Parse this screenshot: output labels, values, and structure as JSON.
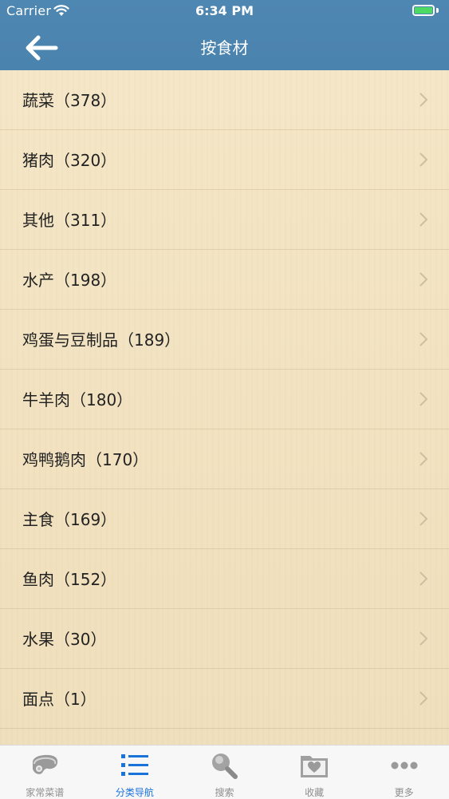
{
  "status_bar": {
    "carrier": "Carrier",
    "time": "6:34 PM"
  },
  "nav": {
    "title": "按食材"
  },
  "categories": [
    {
      "label": "蔬菜（378）"
    },
    {
      "label": "猪肉（320）"
    },
    {
      "label": "其他（311）"
    },
    {
      "label": "水产（198）"
    },
    {
      "label": "鸡蛋与豆制品（189）"
    },
    {
      "label": "牛羊肉（180）"
    },
    {
      "label": "鸡鸭鹅肉（170）"
    },
    {
      "label": "主食（169）"
    },
    {
      "label": "鱼肉（152）"
    },
    {
      "label": "水果（30）"
    },
    {
      "label": "面点（1）"
    }
  ],
  "tabs": [
    {
      "label": "家常菜谱",
      "icon": "steak-icon",
      "active": false
    },
    {
      "label": "分类导航",
      "icon": "list-icon",
      "active": true
    },
    {
      "label": "搜索",
      "icon": "magnifier-icon",
      "active": false
    },
    {
      "label": "收藏",
      "icon": "heart-folder-icon",
      "active": false
    },
    {
      "label": "更多",
      "icon": "more-dots-icon",
      "active": false
    }
  ],
  "colors": {
    "nav_background": "#4a83ad",
    "list_background": "#f1e2c1",
    "active_tab": "#1a73d9",
    "inactive_tab": "#8e8e8e",
    "battery": "#4cd964"
  }
}
